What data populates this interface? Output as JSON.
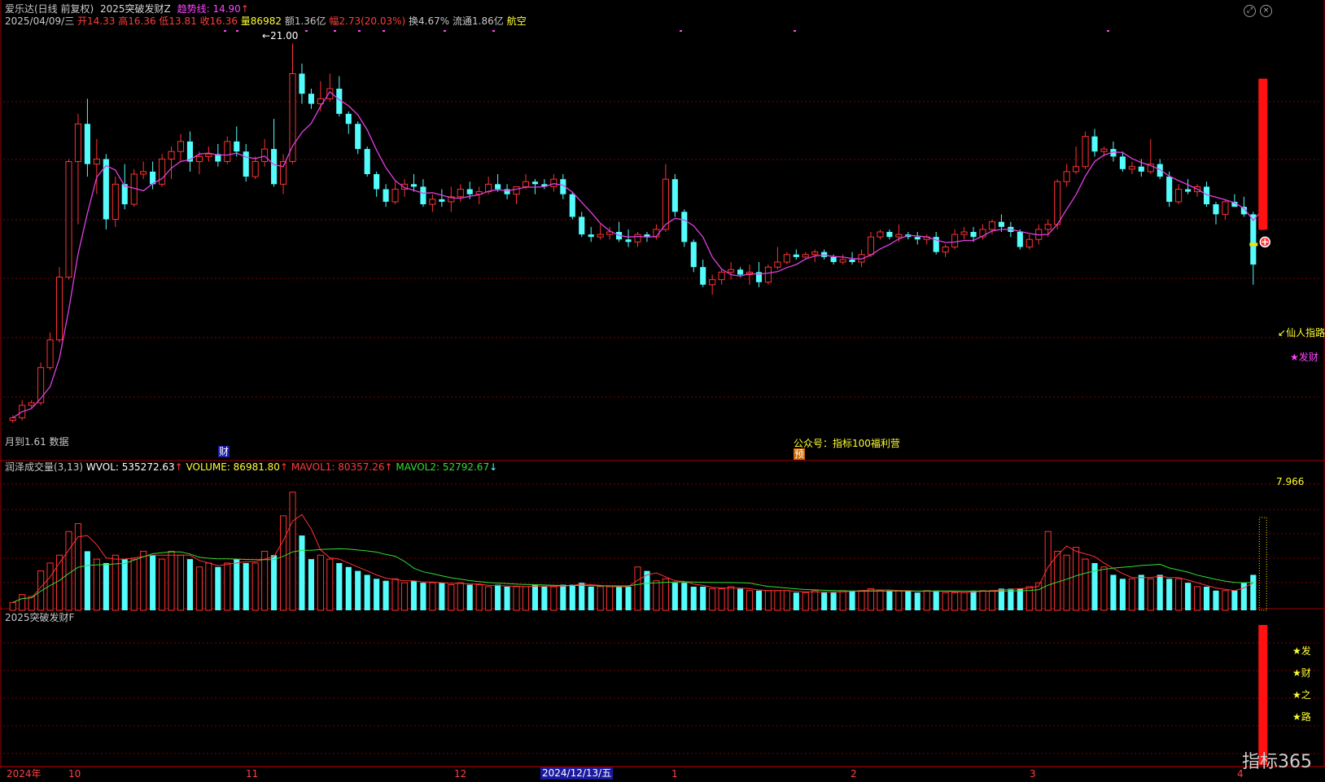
{
  "header": {
    "stock": "爱乐达(日线 前复权)",
    "indicator": "2025突破发财Z",
    "trend_label": "趋势线: 14.90",
    "date": "2025/04/09/三",
    "open": "开14.33",
    "high": "高16.36",
    "low": "低13.81",
    "close": "收16.36",
    "volume": "量86982",
    "amount": "额1.36亿",
    "change": "幅2.73(20.03%)",
    "turnover": "换4.67%",
    "float": "流通1.86亿",
    "sector": "航空"
  },
  "main_chart": {
    "high_marker": "21.00",
    "bottom_left_note": "月到1.61 数据",
    "cai_badge": "财",
    "yu_badge": "预",
    "wechat_note": "公众号：指标100福利营",
    "xianren_label": "仙人指路",
    "facai_label": "发财"
  },
  "volume_panel": {
    "title": "润泽成交量(3,13)",
    "wvol": "WVOL: 535272.63",
    "volume": "VOLUME: 86981.80",
    "mavol1": "MAVOL1: 80357.26",
    "mavol2": "MAVOL2: 52792.67",
    "max_label": "7.966"
  },
  "signal_panel": {
    "title": "2025突破发财F",
    "stars": [
      "★发",
      "★财",
      "★之",
      "★路"
    ]
  },
  "axis": {
    "labels": [
      "2024年",
      "10",
      "11",
      "12",
      "1",
      "2",
      "3",
      "4"
    ],
    "selected": "2024/12/13/五"
  },
  "watermark": "指标365",
  "colors": {
    "up": "#ff3232",
    "down": "#54fcfc",
    "ma": "#e040e0",
    "grid": "#800000"
  },
  "chart_data": {
    "type": "candlestick",
    "y_range_price": [
      5.5,
      21.5
    ],
    "candles": [
      [
        6.0,
        6.2,
        5.9,
        6.1
      ],
      [
        6.1,
        6.8,
        6.0,
        6.6
      ],
      [
        6.6,
        6.8,
        6.5,
        6.7
      ],
      [
        6.7,
        8.3,
        6.6,
        8.1
      ],
      [
        8.1,
        9.5,
        8.0,
        9.2
      ],
      [
        9.2,
        12.1,
        9.1,
        11.7
      ],
      [
        11.7,
        16.4,
        11.6,
        16.3
      ],
      [
        16.3,
        18.2,
        13.8,
        17.8
      ],
      [
        17.8,
        18.8,
        15.7,
        16.2
      ],
      [
        16.2,
        17.2,
        15.0,
        16.4
      ],
      [
        16.4,
        16.6,
        13.6,
        14.0
      ],
      [
        14.0,
        15.7,
        13.7,
        15.4
      ],
      [
        15.4,
        16.2,
        14.4,
        14.6
      ],
      [
        14.6,
        16.0,
        14.5,
        15.8
      ],
      [
        15.8,
        16.3,
        15.6,
        15.9
      ],
      [
        15.9,
        16.3,
        15.2,
        15.4
      ],
      [
        15.4,
        16.6,
        15.3,
        16.4
      ],
      [
        16.4,
        16.9,
        15.6,
        16.7
      ],
      [
        16.7,
        17.4,
        16.3,
        17.1
      ],
      [
        17.1,
        17.5,
        15.9,
        16.3
      ],
      [
        16.3,
        16.7,
        15.8,
        16.5
      ],
      [
        16.5,
        16.9,
        16.3,
        16.6
      ],
      [
        16.6,
        17.0,
        16.1,
        16.3
      ],
      [
        16.3,
        17.3,
        16.2,
        17.1
      ],
      [
        17.1,
        17.7,
        16.5,
        16.7
      ],
      [
        16.7,
        17.0,
        15.5,
        15.7
      ],
      [
        15.7,
        16.5,
        15.6,
        16.3
      ],
      [
        16.3,
        17.2,
        16.1,
        16.8
      ],
      [
        16.8,
        18.0,
        15.3,
        15.4
      ],
      [
        15.4,
        16.6,
        15.0,
        16.3
      ],
      [
        16.3,
        21.0,
        16.2,
        19.8
      ],
      [
        19.8,
        20.2,
        18.6,
        19.0
      ],
      [
        19.0,
        19.2,
        18.4,
        18.6
      ],
      [
        18.6,
        19.5,
        18.3,
        18.8
      ],
      [
        18.8,
        19.8,
        18.7,
        19.2
      ],
      [
        19.2,
        19.7,
        18.1,
        18.2
      ],
      [
        18.2,
        18.3,
        17.4,
        17.8
      ],
      [
        17.8,
        17.9,
        16.6,
        16.8
      ],
      [
        16.8,
        16.9,
        15.7,
        15.8
      ],
      [
        15.8,
        15.9,
        14.9,
        15.2
      ],
      [
        15.2,
        15.4,
        14.5,
        14.7
      ],
      [
        14.7,
        15.5,
        14.6,
        15.2
      ],
      [
        15.2,
        15.6,
        14.9,
        15.4
      ],
      [
        15.4,
        15.8,
        15.1,
        15.3
      ],
      [
        15.3,
        15.6,
        14.5,
        14.6
      ],
      [
        14.6,
        15.0,
        14.3,
        14.8
      ],
      [
        14.8,
        15.2,
        14.5,
        14.7
      ],
      [
        14.7,
        15.3,
        14.3,
        14.9
      ],
      [
        14.9,
        15.4,
        14.7,
        15.2
      ],
      [
        15.2,
        15.5,
        14.8,
        15.0
      ],
      [
        15.0,
        15.3,
        14.6,
        15.1
      ],
      [
        15.1,
        15.7,
        15.0,
        15.4
      ],
      [
        15.4,
        15.8,
        15.1,
        15.2
      ],
      [
        15.2,
        15.4,
        14.8,
        15.0
      ],
      [
        15.0,
        15.3,
        14.6,
        15.3
      ],
      [
        15.3,
        15.8,
        15.2,
        15.5
      ],
      [
        15.5,
        15.6,
        15.0,
        15.4
      ],
      [
        15.4,
        15.6,
        15.2,
        15.3
      ],
      [
        15.3,
        15.8,
        15.1,
        15.6
      ],
      [
        15.6,
        15.8,
        14.8,
        15.0
      ],
      [
        15.0,
        15.1,
        14.0,
        14.1
      ],
      [
        14.1,
        14.3,
        13.3,
        13.4
      ],
      [
        13.4,
        13.7,
        13.1,
        13.3
      ],
      [
        13.3,
        13.8,
        13.2,
        13.4
      ],
      [
        13.4,
        13.7,
        13.2,
        13.5
      ],
      [
        13.5,
        13.9,
        13.1,
        13.2
      ],
      [
        13.2,
        13.6,
        12.9,
        13.1
      ],
      [
        13.1,
        13.5,
        12.9,
        13.4
      ],
      [
        13.4,
        13.5,
        13.1,
        13.3
      ],
      [
        13.3,
        13.8,
        13.2,
        13.6
      ],
      [
        13.6,
        16.2,
        13.5,
        15.6
      ],
      [
        15.6,
        15.8,
        14.1,
        14.3
      ],
      [
        14.3,
        14.4,
        12.9,
        13.1
      ],
      [
        13.1,
        13.2,
        11.9,
        12.1
      ],
      [
        12.1,
        12.4,
        11.3,
        11.4
      ],
      [
        11.4,
        11.8,
        11.0,
        11.6
      ],
      [
        11.6,
        12.0,
        11.4,
        11.9
      ],
      [
        11.9,
        12.3,
        11.6,
        12.0
      ],
      [
        12.0,
        12.1,
        11.7,
        11.8
      ],
      [
        11.8,
        12.2,
        11.4,
        11.9
      ],
      [
        11.9,
        12.3,
        11.3,
        11.5
      ],
      [
        11.5,
        12.2,
        11.4,
        12.1
      ],
      [
        12.1,
        12.9,
        12.0,
        12.3
      ],
      [
        12.3,
        12.7,
        12.2,
        12.6
      ],
      [
        12.6,
        12.8,
        12.4,
        12.5
      ],
      [
        12.5,
        12.7,
        12.4,
        12.6
      ],
      [
        12.6,
        12.8,
        12.3,
        12.7
      ],
      [
        12.7,
        12.8,
        12.4,
        12.5
      ],
      [
        12.5,
        12.6,
        12.2,
        12.3
      ],
      [
        12.3,
        12.6,
        12.2,
        12.4
      ],
      [
        12.4,
        12.7,
        12.2,
        12.3
      ],
      [
        12.3,
        12.8,
        12.1,
        12.6
      ],
      [
        12.6,
        13.5,
        12.5,
        13.3
      ],
      [
        13.3,
        13.6,
        13.2,
        13.5
      ],
      [
        13.5,
        13.6,
        13.2,
        13.3
      ],
      [
        13.3,
        13.8,
        13.1,
        13.4
      ],
      [
        13.4,
        13.5,
        13.2,
        13.3
      ],
      [
        13.3,
        13.5,
        13.0,
        13.2
      ],
      [
        13.2,
        13.4,
        13.0,
        13.3
      ],
      [
        13.3,
        13.5,
        12.6,
        12.7
      ],
      [
        12.7,
        13.0,
        12.5,
        12.9
      ],
      [
        12.9,
        13.6,
        12.8,
        13.4
      ],
      [
        13.4,
        13.7,
        13.2,
        13.5
      ],
      [
        13.5,
        13.7,
        13.1,
        13.3
      ],
      [
        13.3,
        13.8,
        13.2,
        13.6
      ],
      [
        13.6,
        14.0,
        13.4,
        13.9
      ],
      [
        13.9,
        14.2,
        13.5,
        13.7
      ],
      [
        13.7,
        13.9,
        13.3,
        13.5
      ],
      [
        13.5,
        13.6,
        12.8,
        12.9
      ],
      [
        12.9,
        13.4,
        12.8,
        13.2
      ],
      [
        13.2,
        13.8,
        13.0,
        13.6
      ],
      [
        13.6,
        14.0,
        13.3,
        13.8
      ],
      [
        13.8,
        15.6,
        13.6,
        15.5
      ],
      [
        15.5,
        16.2,
        15.3,
        15.9
      ],
      [
        15.9,
        16.9,
        15.8,
        16.1
      ],
      [
        16.1,
        17.5,
        16.0,
        17.3
      ],
      [
        17.3,
        17.6,
        16.5,
        16.7
      ],
      [
        16.7,
        16.9,
        16.5,
        16.8
      ],
      [
        16.8,
        17.1,
        16.3,
        16.5
      ],
      [
        16.5,
        16.7,
        15.9,
        16.0
      ],
      [
        16.0,
        16.3,
        15.8,
        16.1
      ],
      [
        16.1,
        16.4,
        15.7,
        15.9
      ],
      [
        15.9,
        17.2,
        15.8,
        16.2
      ],
      [
        16.2,
        16.4,
        15.6,
        15.7
      ],
      [
        15.7,
        15.9,
        14.5,
        14.7
      ],
      [
        14.7,
        15.4,
        14.6,
        15.2
      ],
      [
        15.2,
        15.6,
        15.0,
        15.1
      ],
      [
        15.1,
        15.4,
        14.9,
        15.3
      ],
      [
        15.3,
        15.5,
        14.5,
        14.6
      ],
      [
        14.6,
        14.7,
        13.8,
        14.2
      ],
      [
        14.2,
        14.8,
        14.0,
        14.7
      ],
      [
        14.7,
        15.0,
        14.5,
        14.5
      ],
      [
        14.5,
        14.9,
        14.1,
        14.2
      ],
      [
        14.2,
        14.3,
        11.4,
        12.2
      ],
      [
        13.6,
        16.36,
        13.6,
        16.36
      ]
    ],
    "volume": [
      4,
      8,
      7,
      20,
      24,
      28,
      40,
      44,
      30,
      26,
      24,
      28,
      26,
      26,
      30,
      28,
      26,
      30,
      28,
      26,
      22,
      24,
      22,
      24,
      26,
      24,
      24,
      30,
      28,
      48,
      60,
      38,
      26,
      28,
      26,
      24,
      22,
      20,
      18,
      16,
      15,
      16,
      14,
      15,
      14,
      14,
      14,
      13,
      14,
      13,
      13,
      12,
      13,
      12,
      12,
      12,
      13,
      12,
      12,
      13,
      13,
      14,
      12,
      12,
      12,
      12,
      12,
      22,
      20,
      15,
      16,
      14,
      14,
      12,
      12,
      11,
      11,
      12,
      11,
      10,
      10,
      10,
      10,
      10,
      9,
      9,
      10,
      9,
      9,
      10,
      10,
      10,
      11,
      10,
      10,
      10,
      10,
      9,
      10,
      10,
      9,
      9,
      9,
      10,
      10,
      10,
      11,
      11,
      11,
      12,
      14,
      40,
      30,
      28,
      32,
      26,
      24,
      22,
      18,
      16,
      16,
      18,
      16,
      18,
      16,
      16,
      14,
      12,
      12,
      10,
      10,
      10,
      14,
      18
    ],
    "volume_max_label": 7.966,
    "signals": [
      "仙人指路",
      "发财"
    ]
  }
}
